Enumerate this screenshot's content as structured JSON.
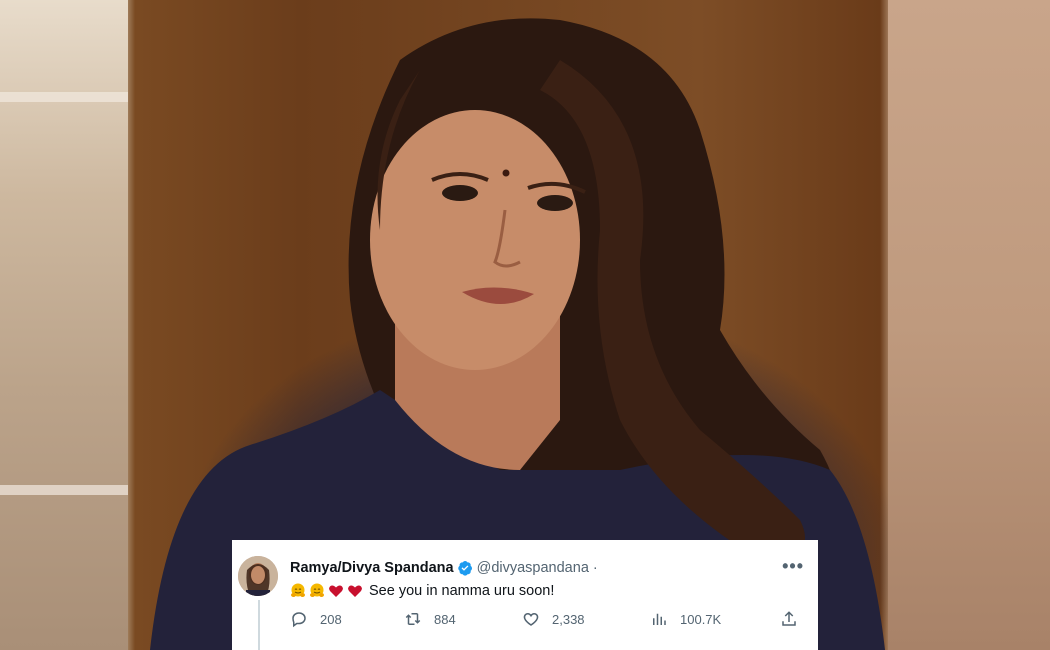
{
  "tweet": {
    "display_name": "Ramya/Divya Spandana",
    "handle": "@divyaspandana",
    "separator": "·",
    "more_label": "•••",
    "emojis": [
      "hugging-face-emoji",
      "hugging-face-emoji",
      "red-heart-emoji",
      "red-heart-emoji"
    ],
    "text": "See you in namma uru soon!",
    "replies": "208",
    "retweets": "884",
    "likes": "2,338",
    "views": "100.7K"
  },
  "colors": {
    "verified": "#1d9bf0",
    "secondary_text": "#536471",
    "primary_text": "#0f1419",
    "heart": "#c8102e",
    "hug": "#f5b800"
  }
}
